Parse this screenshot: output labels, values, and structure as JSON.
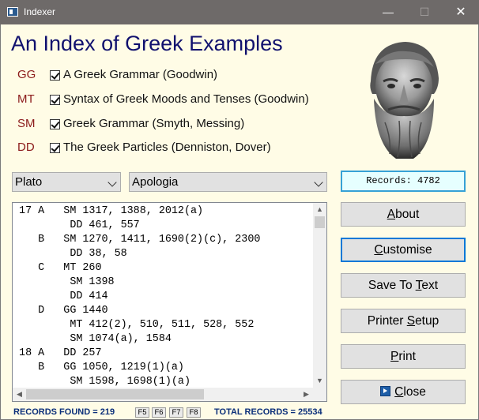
{
  "window": {
    "title": "Indexer",
    "controls": {
      "minimize": "—",
      "maximize": "☐",
      "close": "✕"
    }
  },
  "heading": "An Index of Greek Examples",
  "references": [
    {
      "code": "GG",
      "checked": true,
      "label": "A Greek Grammar (Goodwin)"
    },
    {
      "code": "MT",
      "checked": true,
      "label": "Syntax of Greek Moods and Tenses (Goodwin)"
    },
    {
      "code": "SM",
      "checked": true,
      "label": "Greek Grammar (Smyth, Messing)"
    },
    {
      "code": "DD",
      "checked": true,
      "label": "The Greek Particles (Denniston, Dover)"
    }
  ],
  "author_select": {
    "value": "Plato"
  },
  "work_select": {
    "value": "Apologia"
  },
  "records_display": "Records: 4782",
  "index_lines": [
    " 17 A   SM 1317, 1388, 2012(a)",
    "         DD 461, 557",
    "    B   SM 1270, 1411, 1690(2)(c), 2300",
    "         DD 38, 58",
    "    C   MT 260",
    "         SM 1398",
    "         DD 414",
    "    D   GG 1440",
    "         MT 412(2), 510, 511, 528, 552",
    "         SM 1074(a), 1584",
    " 18 A   DD 257",
    "    B   GG 1050, 1219(1)(a)",
    "         SM 1598, 1698(1)(a)"
  ],
  "buttons": {
    "about": {
      "pre": "",
      "key": "A",
      "post": "bout"
    },
    "customise": {
      "pre": "",
      "key": "C",
      "post": "ustomise"
    },
    "save_to_text": {
      "pre": "Save To ",
      "key": "T",
      "post": "ext"
    },
    "printer_setup": {
      "pre": "Printer ",
      "key": "S",
      "post": "etup"
    },
    "print": {
      "pre": "",
      "key": "P",
      "post": "rint"
    },
    "close": {
      "pre": "",
      "key": "C",
      "post": "lose"
    }
  },
  "status": {
    "records_found": "RECORDS FOUND = 219",
    "function_keys": [
      "F5",
      "F6",
      "F7",
      "F8"
    ],
    "total_records": "TOTAL RECORDS = 25534"
  }
}
